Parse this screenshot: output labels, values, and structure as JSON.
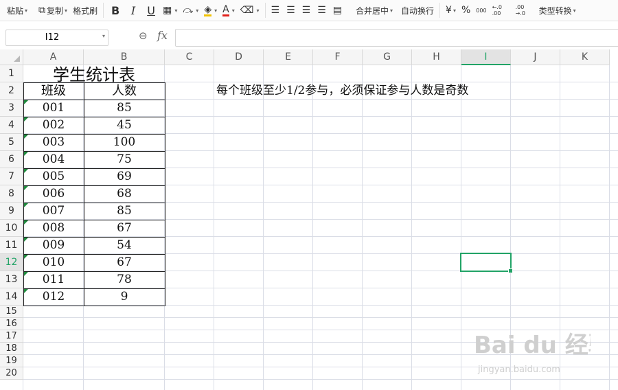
{
  "toolbar": {
    "paste": "粘贴",
    "copy": "复制",
    "format_painter": "格式刷",
    "bold": "B",
    "italic": "I",
    "underline": "U",
    "font_color_letter": "A",
    "merge_center": "合并居中",
    "wrap_text": "自动换行",
    "currency": "¥",
    "percent": "%",
    "thousands": "000",
    "dec_inc": "←.0 .00",
    "dec_dec": ".00 →.0",
    "convert_type": "类型转换"
  },
  "formula_bar": {
    "name_box": "I12",
    "fx": "fx",
    "content": ""
  },
  "columns": [
    "A",
    "B",
    "C",
    "D",
    "E",
    "F",
    "G",
    "H",
    "I",
    "J",
    "K"
  ],
  "rows": [
    "1",
    "2",
    "3",
    "4",
    "5",
    "6",
    "7",
    "8",
    "9",
    "10",
    "11",
    "12",
    "13",
    "14",
    "15",
    "16",
    "17",
    "18",
    "19",
    "20"
  ],
  "selected_cell": {
    "col": "I",
    "row": "12"
  },
  "sheet": {
    "title": "学生统计表",
    "header_class": "班级",
    "header_count": "人数",
    "note": "每个班级至少1/2参与，必须保证参与人数是奇数",
    "records": [
      {
        "cls": "001",
        "count": "85"
      },
      {
        "cls": "002",
        "count": "45"
      },
      {
        "cls": "003",
        "count": "100"
      },
      {
        "cls": "004",
        "count": "75"
      },
      {
        "cls": "005",
        "count": "69"
      },
      {
        "cls": "006",
        "count": "68"
      },
      {
        "cls": "007",
        "count": "85"
      },
      {
        "cls": "008",
        "count": "67"
      },
      {
        "cls": "009",
        "count": "54"
      },
      {
        "cls": "010",
        "count": "67"
      },
      {
        "cls": "011",
        "count": "78"
      },
      {
        "cls": "012",
        "count": "9"
      }
    ]
  },
  "watermark": {
    "logo": "Bai du 经验",
    "url": "jingyan.baidu.com"
  },
  "colors": {
    "accent": "#21a366",
    "grid": "#dadde6",
    "header_bg": "#f5f5f5"
  }
}
